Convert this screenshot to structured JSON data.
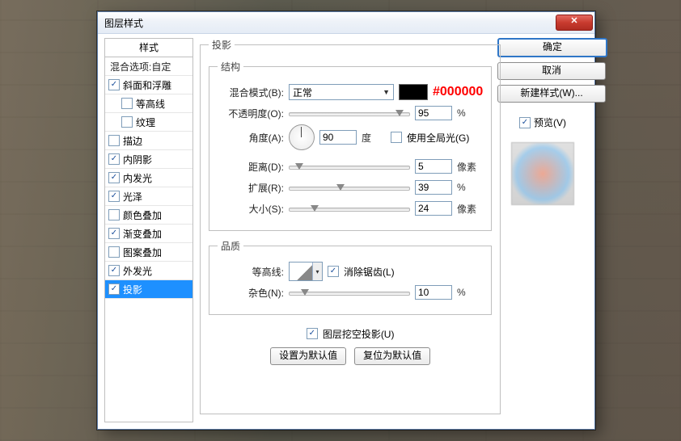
{
  "window": {
    "title": "图层样式"
  },
  "styles": {
    "header": "样式",
    "blend": "混合选项:自定",
    "items": [
      {
        "label": "斜面和浮雕",
        "checked": true,
        "indent": false
      },
      {
        "label": "等高线",
        "checked": false,
        "indent": true
      },
      {
        "label": "纹理",
        "checked": false,
        "indent": true
      },
      {
        "label": "描边",
        "checked": false,
        "indent": false
      },
      {
        "label": "内阴影",
        "checked": true,
        "indent": false
      },
      {
        "label": "内发光",
        "checked": true,
        "indent": false
      },
      {
        "label": "光泽",
        "checked": true,
        "indent": false
      },
      {
        "label": "颜色叠加",
        "checked": false,
        "indent": false
      },
      {
        "label": "渐变叠加",
        "checked": true,
        "indent": false
      },
      {
        "label": "图案叠加",
        "checked": false,
        "indent": false
      },
      {
        "label": "外发光",
        "checked": true,
        "indent": false
      },
      {
        "label": "投影",
        "checked": true,
        "indent": false,
        "selected": true
      }
    ]
  },
  "panel": {
    "title": "投影",
    "structure_legend": "结构",
    "quality_legend": "品质",
    "blend_mode": {
      "label": "混合模式(B):",
      "value": "正常",
      "swatch": "#000000",
      "annotation": "#000000"
    },
    "opacity": {
      "label": "不透明度(O):",
      "value": "95",
      "unit": "%",
      "pos": 88
    },
    "angle": {
      "label": "角度(A):",
      "value": "90",
      "unit": "度",
      "global_label": "使用全局光(G)",
      "global_checked": false
    },
    "distance": {
      "label": "距离(D):",
      "value": "5",
      "unit": "像素",
      "pos": 5
    },
    "spread": {
      "label": "扩展(R):",
      "value": "39",
      "unit": "%",
      "pos": 39
    },
    "size": {
      "label": "大小(S):",
      "value": "24",
      "unit": "像素",
      "pos": 18
    },
    "contour": {
      "label": "等高线:",
      "anti_alias_label": "消除锯齿(L)",
      "anti_alias_checked": true
    },
    "noise": {
      "label": "杂色(N):",
      "value": "10",
      "unit": "%",
      "pos": 10
    },
    "knockout": {
      "label": "图层挖空投影(U)",
      "checked": true
    },
    "defaults": {
      "set": "设置为默认值",
      "reset": "复位为默认值"
    }
  },
  "right": {
    "ok": "确定",
    "cancel": "取消",
    "new_style": "新建样式(W)...",
    "preview_label": "预览(V)",
    "preview_checked": true
  }
}
